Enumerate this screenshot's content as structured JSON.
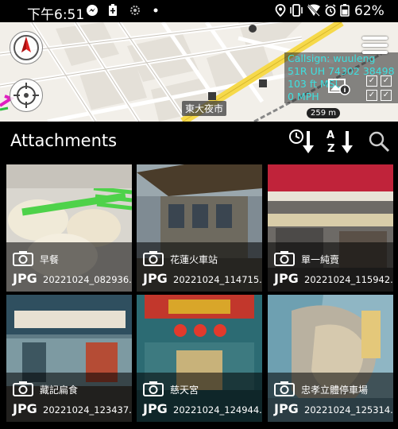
{
  "status_bar": {
    "time": "下午6:51",
    "battery_percent": "62%",
    "icons": [
      "messenger-icon",
      "charge-icon",
      "settings-icon",
      "dot-icon",
      "location-icon",
      "vibrate-icon",
      "wifi-off-icon",
      "alarm-icon",
      "battery-icon"
    ]
  },
  "map": {
    "place_label": "東大夜市",
    "scale_label": "259 m",
    "info": {
      "callsign": "Callsign: wuuleng",
      "coords": "51R  UH 74302 38498",
      "elevation": "103 ft MSL",
      "speed": "0 MPH"
    }
  },
  "attachments": {
    "title": "Attachments",
    "sort_az_label": "A Z",
    "items": [
      {
        "caption": "早餐",
        "type": "JPG",
        "filename": "20221024_082936..."
      },
      {
        "caption": "花蓮火車站",
        "type": "JPG",
        "filename": "20221024_114715..."
      },
      {
        "caption": "單一純賣",
        "type": "JPG",
        "filename": "20221024_115942..."
      },
      {
        "caption": "藏記扁食",
        "type": "JPG",
        "filename": "20221024_123437..."
      },
      {
        "caption": "慈天宮",
        "type": "JPG",
        "filename": "20221024_124944..."
      },
      {
        "caption": "忠孝立體停車場",
        "type": "JPG",
        "filename": "20221024_125314..."
      }
    ]
  },
  "colors": {
    "info_text": "#3ee0e0",
    "map_background": "#f2efe9",
    "major_road": "#f6d94a"
  }
}
